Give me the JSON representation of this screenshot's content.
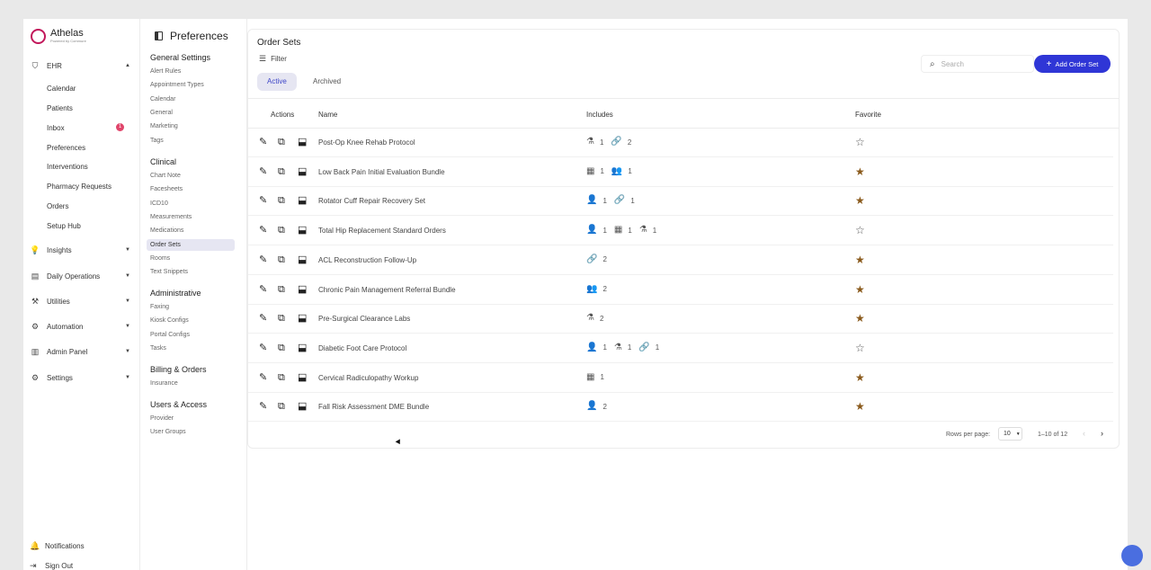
{
  "brand": {
    "name": "Athelas",
    "sub": "Powered by Commure",
    "color": "#c2185b"
  },
  "nav": {
    "ehr": "EHR",
    "ehr_items": [
      "Calendar",
      "Patients",
      "Inbox",
      "Preferences",
      "Interventions",
      "Pharmacy Requests",
      "Orders",
      "Setup Hub"
    ],
    "inbox_badge": "1",
    "sections": [
      "Insights",
      "Daily Operations",
      "Utilities",
      "Automation",
      "Admin Panel",
      "Settings"
    ],
    "footer": [
      "Notifications",
      "Sign Out"
    ]
  },
  "prefs": {
    "title": "Preferences",
    "groups": [
      {
        "title": "General Settings",
        "items": [
          "Alert Rules",
          "Appointment Types",
          "Calendar",
          "General",
          "Marketing",
          "Tags"
        ]
      },
      {
        "title": "Clinical",
        "items": [
          "Chart Note",
          "Facesheets",
          "ICD10",
          "Measurements",
          "Medications",
          "Order Sets",
          "Rooms",
          "Text Snippets"
        ]
      },
      {
        "title": "Administrative",
        "items": [
          "Faxing",
          "Kiosk Configs",
          "Portal Configs",
          "Tasks"
        ]
      },
      {
        "title": "Billing & Orders",
        "items": [
          "Insurance"
        ]
      },
      {
        "title": "Users & Access",
        "items": [
          "Provider",
          "User Groups"
        ]
      }
    ],
    "active": "Order Sets"
  },
  "main": {
    "title": "Order Sets",
    "filter": "Filter",
    "tabs": [
      "Active",
      "Archived"
    ],
    "search_placeholder": "Search",
    "add_button": "Add Order Set",
    "accent": "#2f36d6",
    "columns": [
      "Actions",
      "Name",
      "Includes",
      "Favorite"
    ],
    "rows": [
      {
        "name": "Post-Op Knee Rehab Protocol",
        "includes": [
          {
            "icon": "flask",
            "count": "1"
          },
          {
            "icon": "link",
            "count": "2"
          }
        ],
        "favorite": false
      },
      {
        "name": "Low Back Pain Initial Evaluation Bundle",
        "includes": [
          {
            "icon": "calendar",
            "count": "1"
          },
          {
            "icon": "people",
            "count": "1"
          }
        ],
        "favorite": true
      },
      {
        "name": "Rotator Cuff Repair Recovery Set",
        "includes": [
          {
            "icon": "person",
            "count": "1"
          },
          {
            "icon": "link",
            "count": "1"
          }
        ],
        "favorite": true
      },
      {
        "name": "Total Hip Replacement Standard Orders",
        "includes": [
          {
            "icon": "person",
            "count": "1"
          },
          {
            "icon": "calendar",
            "count": "1"
          },
          {
            "icon": "flask",
            "count": "1"
          }
        ],
        "favorite": false
      },
      {
        "name": "ACL Reconstruction Follow-Up",
        "includes": [
          {
            "icon": "link",
            "count": "2"
          }
        ],
        "favorite": true
      },
      {
        "name": "Chronic Pain Management Referral Bundle",
        "includes": [
          {
            "icon": "people",
            "count": "2"
          }
        ],
        "favorite": true
      },
      {
        "name": "Pre-Surgical Clearance Labs",
        "includes": [
          {
            "icon": "flask",
            "count": "2"
          }
        ],
        "favorite": true
      },
      {
        "name": "Diabetic Foot Care Protocol",
        "includes": [
          {
            "icon": "person",
            "count": "1"
          },
          {
            "icon": "flask",
            "count": "1"
          },
          {
            "icon": "link",
            "count": "1"
          }
        ],
        "favorite": false
      },
      {
        "name": "Cervical Radiculopathy Workup",
        "includes": [
          {
            "icon": "calendar",
            "count": "1"
          }
        ],
        "favorite": true
      },
      {
        "name": "Fall Risk Assessment DME Bundle",
        "includes": [
          {
            "icon": "person",
            "count": "2"
          }
        ],
        "favorite": true
      }
    ],
    "star_color": "#8a5a1c",
    "pagination": {
      "rows_label": "Rows per page:",
      "rows_value": "10",
      "range": "1–10 of 12"
    }
  }
}
